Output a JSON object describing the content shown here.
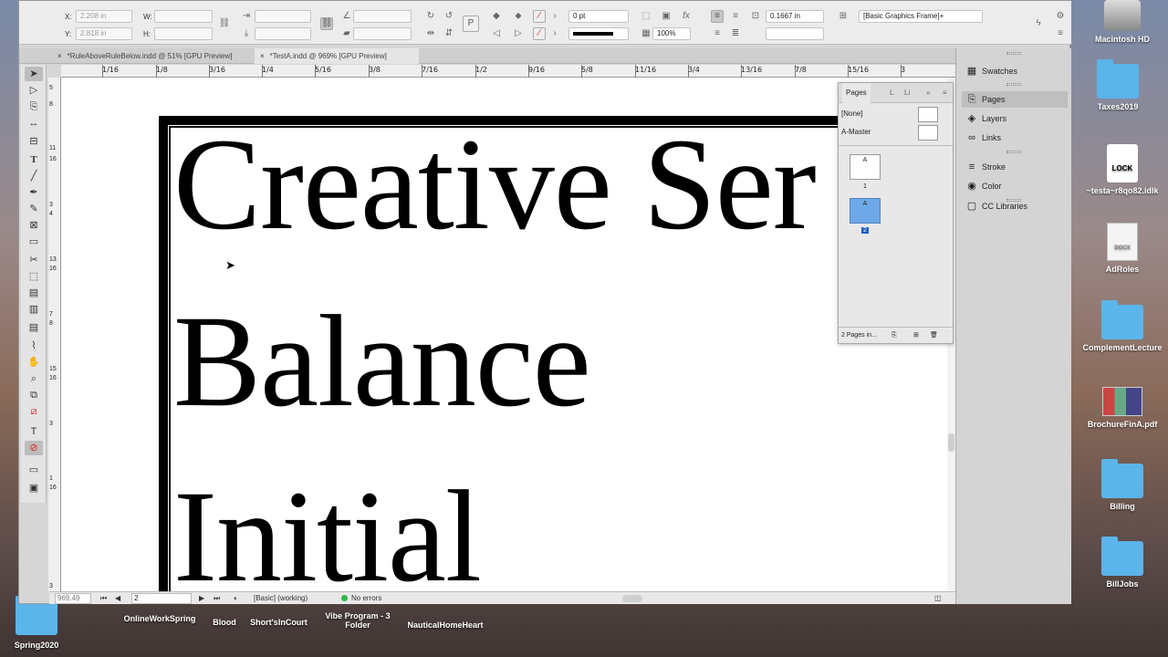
{
  "control_bar": {
    "x_label": "X:",
    "x_value": "2.208 in",
    "y_label": "Y:",
    "y_value": "2.818 in",
    "w_label": "W:",
    "h_label": "H:",
    "stroke_weight": "0 pt",
    "zoom_percent": "100%",
    "inset_value": "0.1667 in",
    "object_style": "[Basic Graphics Frame]+"
  },
  "tabs": [
    {
      "label": "*RuleAboveRuleBelow.indd @ 51% [GPU Preview]"
    },
    {
      "label": "*TestA.indd @ 969% [GPU Preview]"
    }
  ],
  "ruler": {
    "h_ticks": [
      "1/16",
      "1/8",
      "3/16",
      "1/4",
      "5/16",
      "3/8",
      "7/16",
      "1/2",
      "9/16",
      "5/8",
      "11/16",
      "3/4",
      "13/16",
      "7/8",
      "15/16",
      "3"
    ],
    "v_ticks": [
      "5",
      "8",
      "11",
      "16",
      "3",
      "4",
      "13",
      "16",
      "7",
      "8",
      "15",
      "16",
      "3",
      "1",
      "16",
      "3"
    ]
  },
  "document": {
    "lines": [
      "Creative Ser",
      "Balance",
      "Initial"
    ]
  },
  "status_bar": {
    "zoom": "969.49",
    "page": "2",
    "style": "[Basic] (working)",
    "errors": "No errors"
  },
  "dock_panels": [
    {
      "label": "Swatches",
      "icon": "swatches-icon"
    },
    {
      "label": "Pages",
      "icon": "pages-icon"
    },
    {
      "label": "Layers",
      "icon": "layers-icon"
    },
    {
      "label": "Links",
      "icon": "links-icon"
    },
    {
      "label": "Stroke",
      "icon": "stroke-icon"
    },
    {
      "label": "Color",
      "icon": "color-icon"
    },
    {
      "label": "CC Libraries",
      "icon": "cc-libraries-icon"
    }
  ],
  "pages_panel": {
    "tab_pages": "Pages",
    "tab_layers": "L",
    "tab_links": "Li",
    "master_none": "[None]",
    "master_a": "A-Master",
    "page1_label": "1",
    "page2_label": "2",
    "thumb_letter": "A",
    "footer": "2 Pages in..."
  },
  "desktop": {
    "macintosh_hd": "Macintosh HD",
    "taxes": "Taxes2019",
    "lock_file": "~testa~r8qo82.idlk",
    "lock_badge": "LOCK",
    "adroles": "AdRoles",
    "docx_badge": "DOCX",
    "complement": "ComplementLecture",
    "brochure": "BrochureFinA.pdf",
    "billing": "Billing",
    "billjobs": "BillJobs",
    "spring": "Spring2020",
    "onlinework": "OnlineWorkSpring",
    "blood": "Blood",
    "shorts": "Short'sInCourt",
    "vibe": "Vibe Program - 3 Folder",
    "nautical": "NauticalHomeHeart"
  }
}
